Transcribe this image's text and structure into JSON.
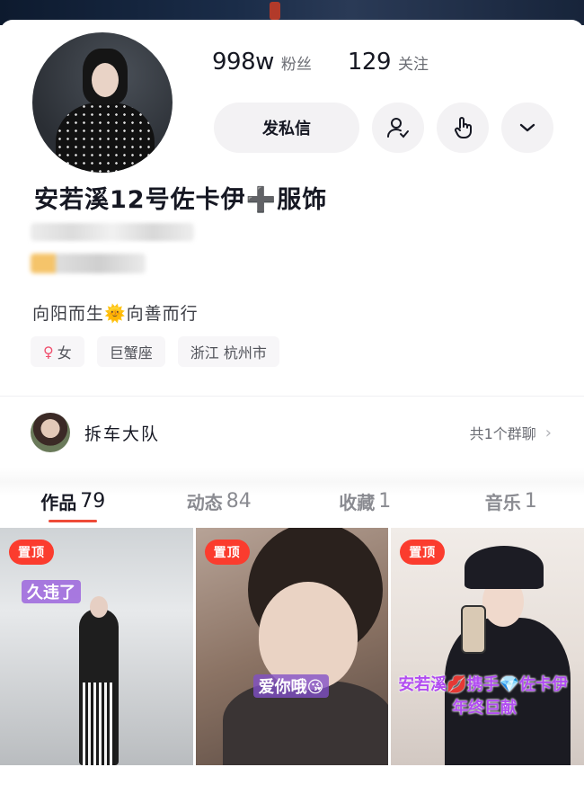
{
  "profile": {
    "nickname": "安若溪12号佐卡伊➕服饰",
    "followers_count": "998w",
    "followers_label": "粉丝",
    "following_count": "129",
    "following_label": "关注",
    "bio": "向阳而生🌞向善而行"
  },
  "actions": {
    "message_label": "发私信",
    "icons": [
      "user-check-icon",
      "hand-tap-icon",
      "chevron-down-icon"
    ]
  },
  "tags": [
    {
      "icon": "♀",
      "label": "女"
    },
    {
      "label": "巨蟹座"
    },
    {
      "label": "浙江 杭州市"
    }
  ],
  "group": {
    "name": "拆车大队",
    "count_text": "共1个群聊"
  },
  "tabs": [
    {
      "label": "作品",
      "count": "79",
      "active": true
    },
    {
      "label": "动态",
      "count": "84",
      "active": false
    },
    {
      "label": "收藏",
      "count": "1",
      "active": false
    },
    {
      "label": "音乐",
      "count": "1",
      "active": false
    }
  ],
  "videos": [
    {
      "badge": "置顶",
      "caption": "久违了"
    },
    {
      "badge": "置顶",
      "caption": "爱你哦😘"
    },
    {
      "badge": "置顶",
      "caption": "安若溪💋携手💎佐卡伊",
      "caption2": "年终巨献"
    }
  ],
  "colors": {
    "accent": "#ee4a37",
    "pin": "#fb3c2e",
    "chip_bg": "#f3f2f4"
  }
}
